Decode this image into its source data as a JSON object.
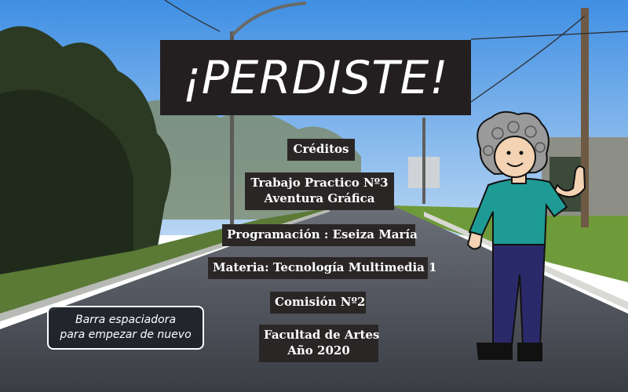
{
  "title": "¡PERDISTE!",
  "credits": {
    "heading": "Créditos",
    "assignment_line1": "Trabajo Practico Nº3",
    "assignment_line2": "Aventura Gráfica",
    "programming": "Programación : Eseiza María",
    "subject": "Materia: Tecnología Multimedia 1",
    "commission": "Comisión Nº2",
    "faculty_line1": "Facultad de Artes",
    "faculty_line2": "Año 2020"
  },
  "restart_hint": {
    "line1": "Barra espaciadora",
    "line2": "para empezar de nuevo"
  },
  "colors": {
    "panel": "#231f20",
    "sky": "#5aa0e6",
    "shirt": "#1e9b94",
    "pants": "#2a2a6a",
    "hair": "#9a9a9a"
  }
}
